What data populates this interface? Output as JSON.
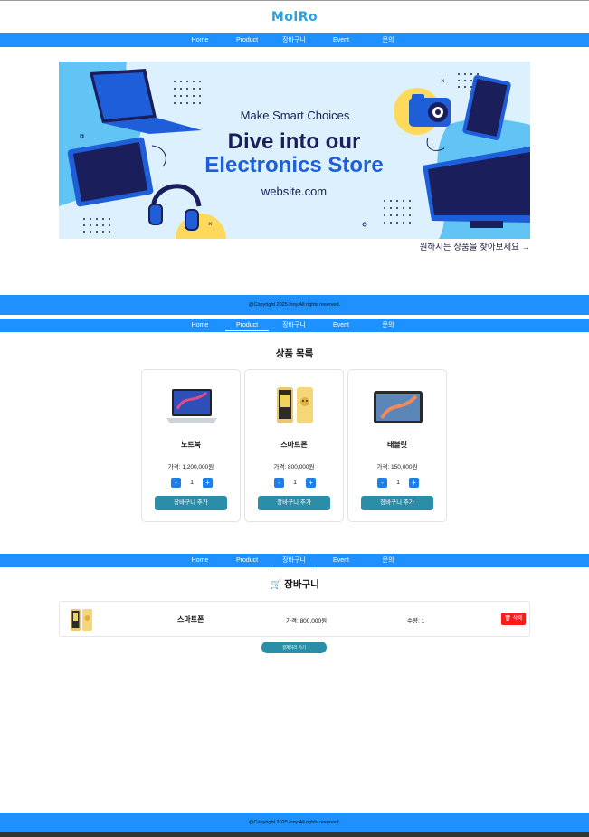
{
  "app": {
    "logo": "MolRo"
  },
  "nav": {
    "items": [
      "Home",
      "Product",
      "장바구니",
      "Event",
      "문의"
    ]
  },
  "banner": {
    "headline_small": "Make Smart Choices",
    "headline_line1": "Dive into our",
    "headline_line2": "Electronics Store",
    "website": "website.com",
    "colors": {
      "background": "#dcf1fd",
      "accent_blue": "#1e5fd9",
      "navy": "#1a1f5c",
      "yellow": "#ffd95c",
      "light_blue": "#62c4f5"
    }
  },
  "banner_link": "원하시는 상품을 찾아보세요 →",
  "footer": {
    "copyright": "@Copyright 2025.inny.All rights reserved."
  },
  "products": {
    "title": "상품 목록",
    "items": [
      {
        "name": "노트북",
        "price": "가격: 1,200,000원",
        "qty": "1",
        "add_label": "장바구니 추가",
        "icon": "laptop-icon"
      },
      {
        "name": "스마트폰",
        "price": "가격: 800,000원",
        "qty": "1",
        "add_label": "장바구니 추가",
        "icon": "smartphone-icon"
      },
      {
        "name": "태블릿",
        "price": "가격: 150,000원",
        "qty": "1",
        "add_label": "장바구니 추가",
        "icon": "tablet-icon"
      }
    ],
    "minus": "-",
    "plus": "+"
  },
  "cart": {
    "title": "🛒 장바구니",
    "items": [
      {
        "name": "스마트폰",
        "price": "가격: 800,000원",
        "qty": "수량: 1",
        "delete_label": "🗑 삭제",
        "icon": "smartphone-icon"
      }
    ],
    "checkout_label": "결제하러 가기"
  },
  "colors": {
    "primary": "#1e90ff",
    "logo": "#2aa1e0",
    "button_teal": "#2a8ea8",
    "qty_button": "#1e7fe8",
    "delete_red": "#ff1a1a"
  }
}
